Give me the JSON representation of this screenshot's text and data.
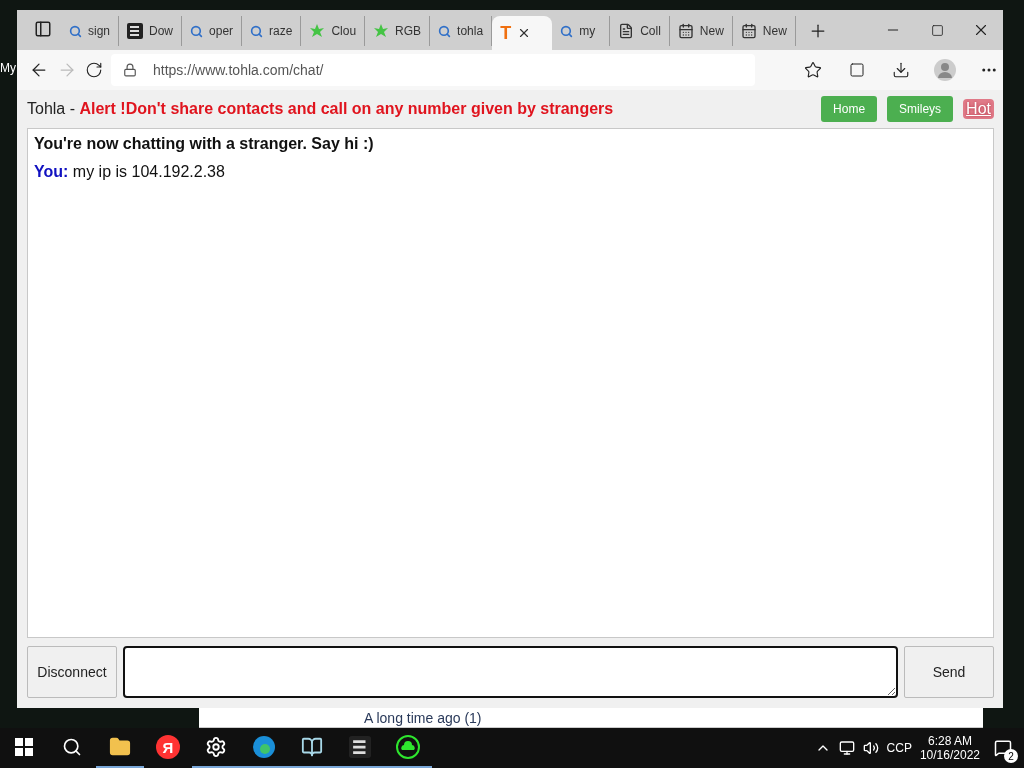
{
  "desktop": {
    "icon_label": "My"
  },
  "tabs": [
    {
      "kind": "search",
      "label": "sign",
      "selected": false
    },
    {
      "kind": "s-logo",
      "label": "Dow",
      "selected": false
    },
    {
      "kind": "search",
      "label": "oper",
      "selected": false
    },
    {
      "kind": "search",
      "label": "raze",
      "selected": false
    },
    {
      "kind": "leaf",
      "label": "Clou",
      "selected": false
    },
    {
      "kind": "leaf",
      "label": "RGB",
      "selected": false
    },
    {
      "kind": "search",
      "label": "tohla",
      "selected": false
    },
    {
      "kind": "t-logo",
      "logo": "T",
      "selected": true
    },
    {
      "kind": "search",
      "label": "my",
      "selected": false
    },
    {
      "kind": "page",
      "label": "Coll",
      "selected": false
    },
    {
      "kind": "newtab",
      "label": "New",
      "selected": false
    },
    {
      "kind": "newtab",
      "label": "New",
      "selected": false
    }
  ],
  "address": {
    "url": "https://www.tohla.com/chat/"
  },
  "header": {
    "site": "Tohla - ",
    "alert": "Alert !Don't share contacts and call on any number given by strangers",
    "buttons": [
      "Home",
      "Smileys"
    ],
    "hot_link": "Hot"
  },
  "chat": {
    "status": "You're now chatting with a stranger. Say hi :)",
    "messages": [
      {
        "speaker": "You:",
        "text": "my ip is 104.192.2.38"
      }
    ]
  },
  "composer": {
    "disconnect": "Disconnect",
    "send": "Send"
  },
  "background_window": {
    "group": "A long time ago (1)"
  },
  "taskbar": {
    "apps": [
      {
        "kind": "folder",
        "running": true
      },
      {
        "kind": "yandex",
        "glyph": "Я",
        "running": false
      },
      {
        "kind": "settings",
        "running": true
      },
      {
        "kind": "edge",
        "running": true
      },
      {
        "kind": "notes",
        "running": true
      },
      {
        "kind": "s-app",
        "running": true
      },
      {
        "kind": "cloud",
        "running": true
      }
    ],
    "language": "CCP",
    "time": "6:28 AM",
    "date": "10/16/2022",
    "notifications": "2"
  }
}
